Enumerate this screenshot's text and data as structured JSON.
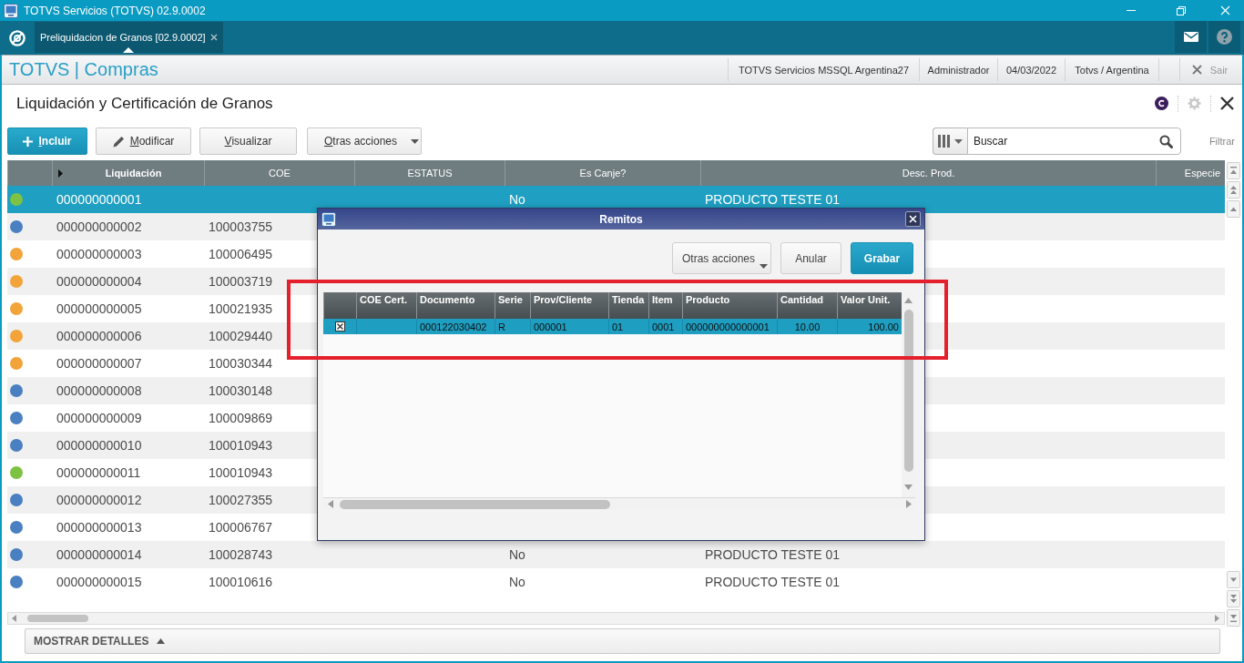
{
  "window": {
    "title": "TOTVS Servicios (TOTVS) 02.9.0002"
  },
  "tabs": [
    {
      "label": "Preliquidacion de Granos [02.9.0002]",
      "selected": true
    }
  ],
  "header": {
    "brand": "TOTVS | Compras",
    "info": [
      "TOTVS Servicios MSSQL Argentina27",
      "Administrador",
      "04/03/2022",
      "Totvs / Argentina"
    ],
    "exit": "Sair"
  },
  "page": {
    "title": "Liquidación y Certificación de Granos"
  },
  "toolbar": {
    "buttons": [
      {
        "label": "Incluir",
        "kind": "add"
      },
      {
        "label": "Modificar",
        "kind": "edit"
      },
      {
        "label": "Visualizar",
        "kind": "view"
      },
      {
        "label": "Otras acciones",
        "kind": "menu"
      }
    ],
    "search": {
      "placeholder": "Buscar"
    },
    "filter": "Filtrar"
  },
  "table": {
    "columns": [
      "Liquidación",
      "COE",
      "ESTATUS",
      "Es Canje?",
      "Desc. Prod.",
      "Especie"
    ],
    "rows": [
      {
        "selected": true,
        "color": "#7dc242",
        "liquidacion": "000000000001",
        "es_canje": "No",
        "desc_prod": "PRODUCTO TESTE 01"
      },
      {
        "selected": false,
        "color": "#4a7fc1",
        "liquidacion": "000000000002",
        "coe": "100003755"
      },
      {
        "selected": false,
        "color": "#f2a33a",
        "liquidacion": "000000000003",
        "coe": "100006495"
      },
      {
        "selected": false,
        "color": "#f2a33a",
        "liquidacion": "000000000004",
        "coe": "100003719"
      },
      {
        "selected": false,
        "color": "#f2a33a",
        "liquidacion": "000000000005",
        "coe": "100021935"
      },
      {
        "selected": false,
        "color": "#f2a33a",
        "liquidacion": "000000000006",
        "coe": "100029440"
      },
      {
        "selected": false,
        "color": "#f2a33a",
        "liquidacion": "000000000007",
        "coe": "100030344"
      },
      {
        "selected": false,
        "color": "#4a7fc1",
        "liquidacion": "000000000008",
        "coe": "100030148"
      },
      {
        "selected": false,
        "color": "#4a7fc1",
        "liquidacion": "000000000009",
        "coe": "100009869"
      },
      {
        "selected": false,
        "color": "#4a7fc1",
        "liquidacion": "000000000010",
        "coe": "100010943"
      },
      {
        "selected": false,
        "color": "#7dc242",
        "liquidacion": "000000000011",
        "coe": "100010943"
      },
      {
        "selected": false,
        "color": "#4a7fc1",
        "liquidacion": "000000000012",
        "coe": "100027355"
      },
      {
        "selected": false,
        "color": "#4a7fc1",
        "liquidacion": "000000000013",
        "coe": "100006767"
      },
      {
        "selected": false,
        "color": "#4a7fc1",
        "liquidacion": "000000000014",
        "coe": "100028743",
        "es_canje": "No",
        "desc_prod": "PRODUCTO TESTE 01"
      },
      {
        "selected": false,
        "color": "#4a7fc1",
        "liquidacion": "000000000015",
        "coe": "100010616",
        "es_canje": "No",
        "desc_prod": "PRODUCTO TESTE 01"
      }
    ]
  },
  "details_bar": {
    "label": "MOSTRAR DETALLES"
  },
  "dialog": {
    "title": "Remitos",
    "buttons": [
      {
        "label": "Otras acciones",
        "kind": "menu"
      },
      {
        "label": "Anular",
        "kind": "cancel"
      },
      {
        "label": "Grabar",
        "kind": "save"
      }
    ],
    "table": {
      "columns": [
        "COE Cert.",
        "Documento",
        "Serie",
        "Prov/Cliente",
        "Tienda",
        "Item",
        "Producto",
        "Cantidad",
        "Valor Unit."
      ],
      "rows": [
        {
          "selected": true,
          "checked": true,
          "documento": "000122030402",
          "serie": "R",
          "prov_cliente": "000001",
          "tienda": "01",
          "item": "0001",
          "producto": "000000000000001",
          "cantidad": "10.00",
          "valor_unit": "100.00"
        }
      ]
    }
  },
  "annotation": {
    "kind": "rectangle"
  }
}
